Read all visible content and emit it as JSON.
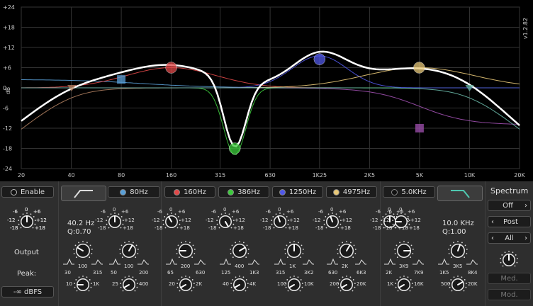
{
  "graph": {
    "version": "v1.2.82",
    "db_unit": "dB",
    "y_ticks": [
      "+24",
      "+18",
      "+12",
      "+6",
      "0",
      "-6",
      "-12",
      "-18",
      "-24"
    ],
    "x_ticks": [
      "20",
      "40",
      "80",
      "160",
      "315",
      "630",
      "1K25",
      "2K5",
      "5K",
      "10K",
      "20K"
    ]
  },
  "bands": [
    {
      "id": "hp",
      "label": "",
      "led_color": "#777777",
      "type": "highpass",
      "gain_scale": [
        "-6",
        "0",
        "+6",
        "-12",
        "+12",
        "-18",
        "+18"
      ],
      "readout_freq": "40.2 Hz",
      "readout_q": "Q:0.70",
      "freq_scale": [
        "100",
        "30",
        "315",
        "10",
        "1K"
      ]
    },
    {
      "id": "b1",
      "label": "80Hz",
      "led_color": "#5aa0d8",
      "type": "shelf",
      "gain_scale": [
        "-6",
        "0",
        "+6",
        "-12",
        "+12",
        "-18",
        "+18"
      ],
      "freq_scale": [
        "100",
        "50",
        "200",
        "25",
        "400"
      ]
    },
    {
      "id": "b2",
      "label": "160Hz",
      "led_color": "#e04848",
      "type": "bell",
      "gain_scale": [
        "-6",
        "0",
        "+6",
        "-12",
        "+12",
        "-18",
        "+18"
      ],
      "freq_scale": [
        "200",
        "65",
        "630",
        "20",
        "2K"
      ]
    },
    {
      "id": "b3",
      "label": "386Hz",
      "led_color": "#3ccc3c",
      "type": "bell",
      "gain_scale": [
        "-6",
        "0",
        "+6",
        "-12",
        "+12",
        "-18",
        "+18"
      ],
      "freq_scale": [
        "400",
        "125",
        "1K3",
        "40",
        "4K"
      ]
    },
    {
      "id": "b4",
      "label": "1250Hz",
      "led_color": "#5058e8",
      "type": "bell",
      "gain_scale": [
        "-6",
        "0",
        "+6",
        "-12",
        "+12",
        "-18",
        "+18"
      ],
      "freq_scale": [
        "1K",
        "315",
        "3K2",
        "100",
        "10K"
      ]
    },
    {
      "id": "b5",
      "label": "4975Hz",
      "led_color": "#e8c878",
      "type": "bell",
      "gain_scale": [
        "-6",
        "0",
        "+6",
        "-12",
        "+12",
        "-18",
        "+18"
      ],
      "freq_scale": [
        "2K",
        "630",
        "6K3",
        "200",
        "20K"
      ]
    },
    {
      "id": "b6",
      "label": "5.0KHz",
      "led_color": "#111111",
      "type": "shelf",
      "gain_scale": [
        "-6",
        "0",
        "+6",
        "-12",
        "+12",
        "-18",
        "+18"
      ],
      "freq_scale": [
        "3K9",
        "2K",
        "7K9",
        "1K",
        "16K"
      ]
    },
    {
      "id": "lp",
      "label": "",
      "led_color": "#777777",
      "type": "lowpass",
      "gain_scale": [
        "-6",
        "0",
        "+6",
        "-12",
        "+12",
        "-18",
        "+18"
      ],
      "readout_freq": "10.0 KHz",
      "readout_q": "Q:1.00",
      "freq_scale": [
        "3K5",
        "1K5",
        "8K4",
        "500",
        "20K"
      ]
    }
  ],
  "left": {
    "enable_label": "Enable",
    "output_label": "Output",
    "peak_label": "Peak:",
    "peak_value": "-∞ dBFS"
  },
  "spectrum": {
    "title": "Spectrum",
    "mode": "Off",
    "position": "Post",
    "channel": "All",
    "med_label": "Med.",
    "mod_label": "Mod."
  },
  "colors": {
    "bg": "#2e2e2e",
    "graph_bg": "#000000",
    "curve": "#ffffff"
  }
}
